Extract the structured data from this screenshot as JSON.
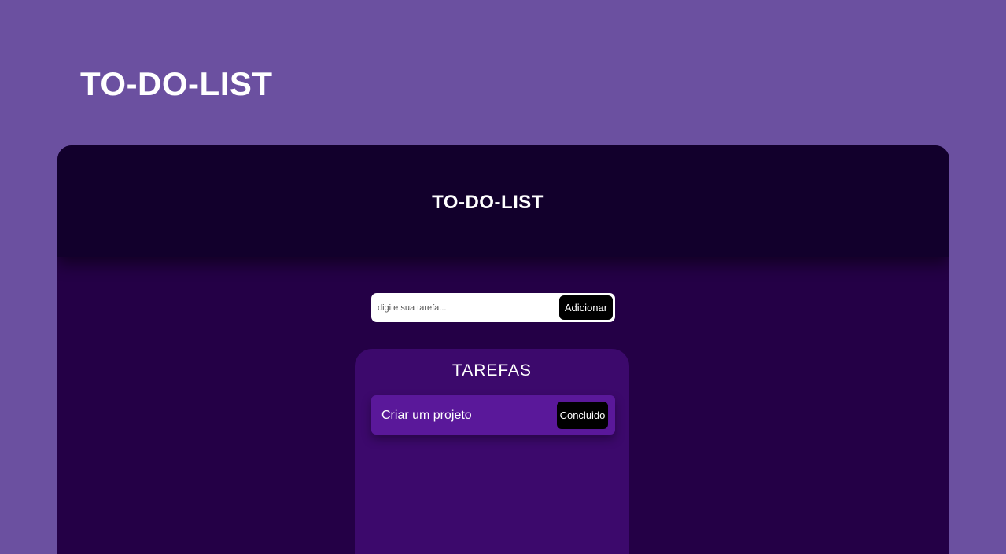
{
  "page": {
    "title": "TO-DO-LIST"
  },
  "app": {
    "header_title": "TO-DO-LIST",
    "form": {
      "input_placeholder": "digite sua tarefa...",
      "input_value": "",
      "add_button_label": "Adicionar"
    },
    "tasks": {
      "title": "TAREFAS",
      "items": [
        {
          "text": "Criar um projeto",
          "done_button_label": "Concluido"
        }
      ]
    }
  },
  "colors": {
    "page_background": "#6b50a0",
    "header_background": "#12002c",
    "app_background": "#240046",
    "panel_background": "#3c096c",
    "task_background": "#5a189a",
    "button_background": "#000000"
  }
}
